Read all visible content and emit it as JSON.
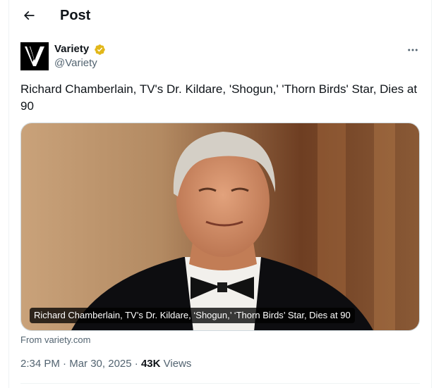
{
  "header": {
    "title": "Post"
  },
  "author": {
    "name": "Variety",
    "handle": "@Variety",
    "verified_color": "#e2b719"
  },
  "tweet": {
    "text": "Richard Chamberlain, TV's Dr. Kildare, 'Shogun,' 'Thorn Birds' Star, Dies at 90"
  },
  "media": {
    "caption": "Richard Chamberlain, TV’s Dr. Kildare, ‘Shogun,’ ‘Thorn Birds’ Star, Dies at 90"
  },
  "source": "From variety.com",
  "meta": {
    "time": "2:34 PM",
    "sep": "·",
    "date": "Mar 30, 2025",
    "views_count": "43K",
    "views_label": "Views"
  },
  "icons": {
    "back": "arrow-left-icon",
    "more": "more-horizontal-icon",
    "verified": "verified-badge-icon"
  }
}
